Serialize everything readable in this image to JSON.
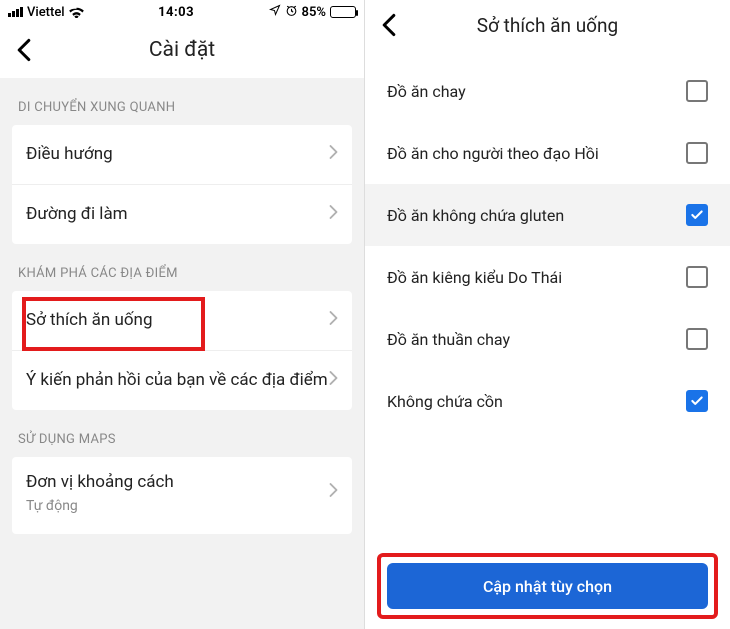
{
  "statusbar": {
    "carrier": "Viettel",
    "time": "14:03",
    "battery_pct": "85%"
  },
  "left": {
    "title": "Cài đặt",
    "section1": "DI CHUYỂN XUNG QUANH",
    "row_nav": "Điều hướng",
    "row_commute": "Đường đi làm",
    "section2": "KHÁM PHÁ CÁC ĐỊA ĐIỂM",
    "row_food_pref": "Sở thích ăn uống",
    "row_feedback": "Ý kiến phản hồi của bạn về các địa điểm",
    "section3": "SỬ DỤNG MAPS",
    "row_distance": "Đơn vị khoảng cách",
    "row_distance_sub": "Tự động"
  },
  "right": {
    "title": "Sở thích ăn uống",
    "items": [
      {
        "label": "Đồ ăn chay",
        "checked": false
      },
      {
        "label": "Đồ ăn cho người theo đạo Hồi",
        "checked": false
      },
      {
        "label": "Đồ ăn không chứa gluten",
        "checked": true,
        "selected": true
      },
      {
        "label": "Đồ ăn kiêng kiểu Do Thái",
        "checked": false
      },
      {
        "label": "Đồ ăn thuần chay",
        "checked": false
      },
      {
        "label": "Không chứa cồn",
        "checked": true
      }
    ],
    "update_btn": "Cập nhật tùy chọn"
  }
}
